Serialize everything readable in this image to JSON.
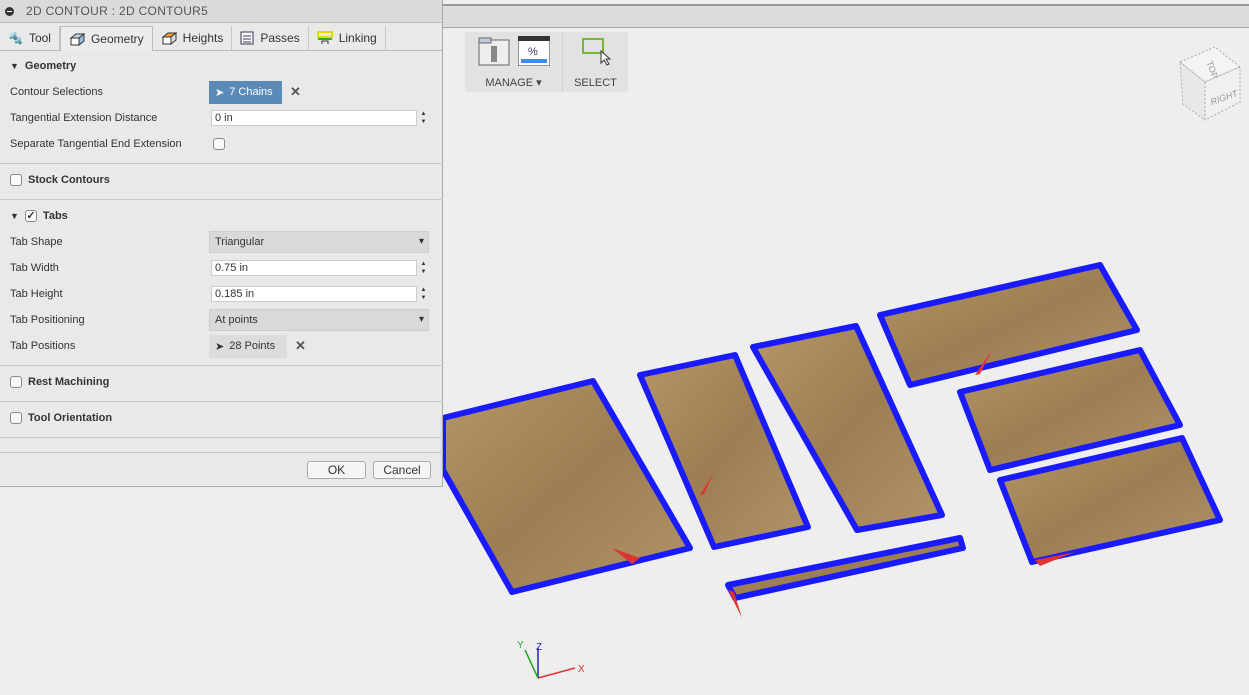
{
  "dialog": {
    "title": "2D CONTOUR : 2D CONTOUR5",
    "tabs": [
      {
        "label": "Tool",
        "icon": "tool-icon"
      },
      {
        "label": "Geometry",
        "icon": "geometry-icon",
        "active": true
      },
      {
        "label": "Heights",
        "icon": "heights-icon"
      },
      {
        "label": "Passes",
        "icon": "passes-icon"
      },
      {
        "label": "Linking",
        "icon": "linking-icon"
      }
    ],
    "geometry": {
      "header": "Geometry",
      "contour_label": "Contour Selections",
      "contour_value": "7 Chains",
      "tangential_label": "Tangential Extension Distance",
      "tangential_value": "0 in",
      "separate_label": "Separate Tangential End Extension",
      "separate_checked": false
    },
    "stock_contours": {
      "header": "Stock Contours",
      "checked": false
    },
    "tabs_section": {
      "header": "Tabs",
      "checked": true,
      "shape_label": "Tab Shape",
      "shape_value": "Triangular",
      "width_label": "Tab Width",
      "width_value": "0.75 in",
      "height_label": "Tab Height",
      "height_value": "0.185 in",
      "positioning_label": "Tab Positioning",
      "positioning_value": "At points",
      "positions_label": "Tab Positions",
      "positions_value": "28 Points"
    },
    "rest_machining": {
      "header": "Rest Machining",
      "checked": false
    },
    "tool_orientation": {
      "header": "Tool Orientation",
      "checked": false
    },
    "ok_label": "OK",
    "cancel_label": "Cancel"
  },
  "ribbon": {
    "manage_label": "MANAGE ▾",
    "select_label": "SELECT"
  },
  "viewcube": {
    "top": "TOP",
    "right": "RIGHT"
  },
  "axes": {
    "x": "X",
    "y": "Y",
    "z": "Z"
  },
  "colors": {
    "selected_chain": "#1a1aff",
    "wood": "#a88a5e",
    "accent": "#5a8ab8"
  }
}
